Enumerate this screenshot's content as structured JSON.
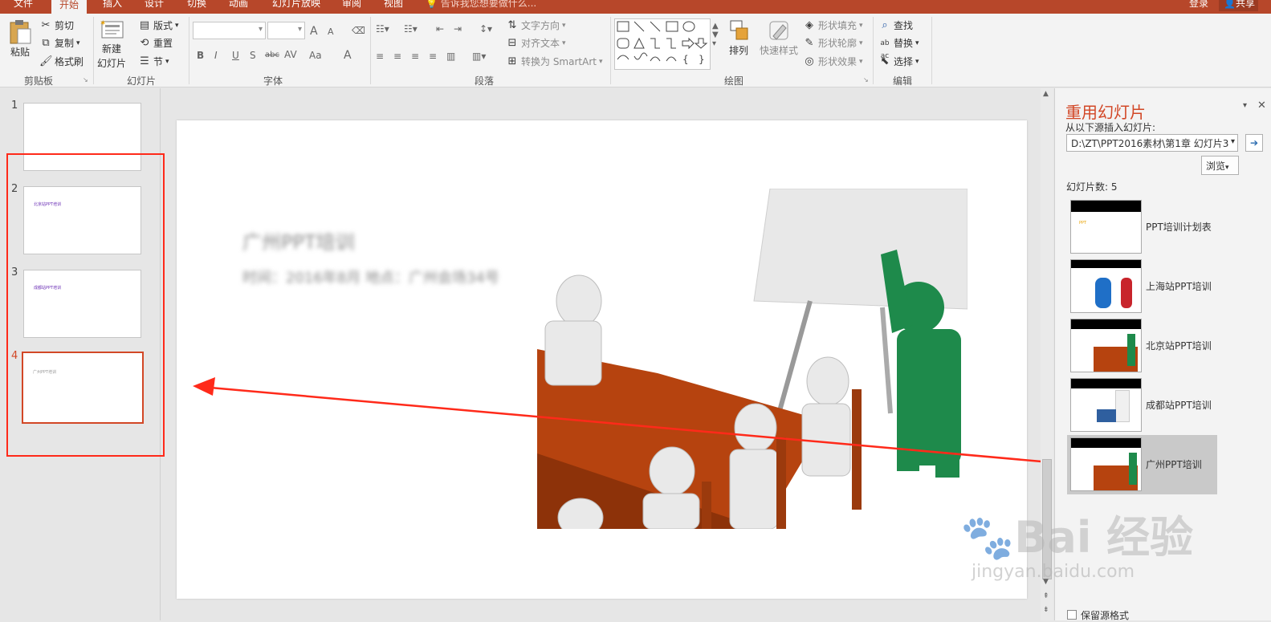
{
  "tabs": [
    "文件",
    "开始",
    "插入",
    "设计",
    "切换",
    "动画",
    "幻灯片放映",
    "审阅",
    "视图"
  ],
  "tell_me": "告诉我您想要做什么...",
  "login": "登录",
  "share": "共享",
  "clipboard": {
    "paste": "粘贴",
    "cut": "剪切",
    "copy": "复制",
    "format_painter": "格式刷",
    "label": "剪贴板"
  },
  "slides_group": {
    "new_slide_line1": "新建",
    "new_slide_line2": "幻灯片",
    "layout": "版式",
    "reset": "重置",
    "section": "节",
    "label": "幻灯片"
  },
  "font_group": {
    "label": "字体",
    "bold": "B",
    "italic": "I",
    "underline": "U",
    "shadow": "S",
    "strike": "abc",
    "spacing": "AV",
    "case": "Aa",
    "color": "A",
    "grow": "A",
    "shrink": "A"
  },
  "paragraph_group": {
    "label": "段落",
    "text_direction": "文字方向",
    "align_text": "对齐文本",
    "convert_smartart": "转换为 SmartArt"
  },
  "drawing_group": {
    "label": "绘图",
    "arrange": "排列",
    "quick_styles": "快速样式",
    "shape_fill": "形状填充",
    "shape_outline": "形状轮廓",
    "shape_effects": "形状效果"
  },
  "editing_group": {
    "label": "编辑",
    "find": "查找",
    "replace": "替换",
    "select": "选择"
  },
  "slide_numbers": [
    "1",
    "2",
    "3",
    "4"
  ],
  "thumb_titles": [
    "北京站PPT培训",
    "成都站PPT培训",
    "广州PPT培训"
  ],
  "reuse_pane": {
    "title": "重用幻灯片",
    "insert_from": "从以下源插入幻灯片:",
    "path": "D:\\ZT\\PPT2016素材\\第1章 幻灯片3",
    "browse": "浏览",
    "count": "幻灯片数: 5",
    "slides": [
      "PPT培训计划表",
      "上海站PPT培训",
      "北京站PPT培训",
      "成都站PPT培训",
      "广州PPT培训"
    ],
    "keep_format": "保留源格式"
  },
  "slide_text": {
    "line1": "广州PPT培训",
    "line2": "时间：2016年8月 地点：广州会场34号"
  },
  "watermark": {
    "brand": "Bai 经验",
    "url": "jingyan.baidu.com"
  },
  "colors": {
    "accent": "#b7472a",
    "selection": "#d24726",
    "annotation": "#ff2a1a",
    "title_orange": "#d24726"
  }
}
